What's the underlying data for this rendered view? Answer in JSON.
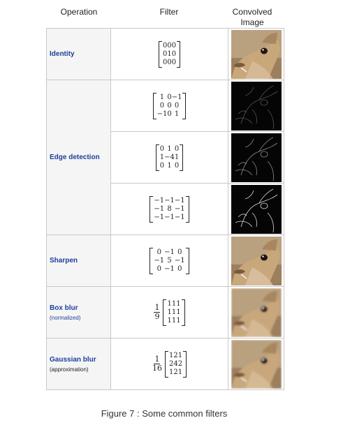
{
  "headers": {
    "operation": "Operation",
    "filter": "Filter",
    "image": "Convolved Image"
  },
  "rows": [
    {
      "operation": "Identity",
      "subtitle": "",
      "scale": "",
      "matrix": [
        [
          "0",
          "0",
          "0"
        ],
        [
          "0",
          "1",
          "0"
        ],
        [
          "0",
          "0",
          "0"
        ]
      ],
      "image_kind": "photo"
    },
    {
      "operation": "",
      "subtitle": "",
      "scale": "",
      "matrix": [
        [
          "1",
          "0",
          "−1"
        ],
        [
          "0",
          "0",
          "0"
        ],
        [
          "−1",
          "0",
          "1"
        ]
      ],
      "image_kind": "edge-faint"
    },
    {
      "operation": "Edge detection",
      "subtitle": "",
      "scale": "",
      "matrix": [
        [
          "0",
          "1",
          "0"
        ],
        [
          "1",
          "−4",
          "1"
        ],
        [
          "0",
          "1",
          "0"
        ]
      ],
      "image_kind": "edge-medium"
    },
    {
      "operation": "",
      "subtitle": "",
      "scale": "",
      "matrix": [
        [
          "−1",
          "−1",
          "−1"
        ],
        [
          "−1",
          "8",
          "−1"
        ],
        [
          "−1",
          "−1",
          "−1"
        ]
      ],
      "image_kind": "edge-strong"
    },
    {
      "operation": "Sharpen",
      "subtitle": "",
      "scale": "",
      "matrix": [
        [
          "0",
          "−1",
          "0"
        ],
        [
          "−1",
          "5",
          "−1"
        ],
        [
          "0",
          "−1",
          "0"
        ]
      ],
      "image_kind": "sharp"
    },
    {
      "operation": "Box blur",
      "subtitle": "(normalized)",
      "scale_num": "1",
      "scale_den": "9",
      "matrix": [
        [
          "1",
          "1",
          "1"
        ],
        [
          "1",
          "1",
          "1"
        ],
        [
          "1",
          "1",
          "1"
        ]
      ],
      "image_kind": "blur"
    },
    {
      "operation": "Gaussian blur",
      "subtitle": "(approximation)",
      "scale_num": "1",
      "scale_den": "16",
      "matrix": [
        [
          "1",
          "2",
          "1"
        ],
        [
          "2",
          "4",
          "2"
        ],
        [
          "1",
          "2",
          "1"
        ]
      ],
      "image_kind": "blur"
    }
  ],
  "caption": "Figure 7 : Some common filters"
}
